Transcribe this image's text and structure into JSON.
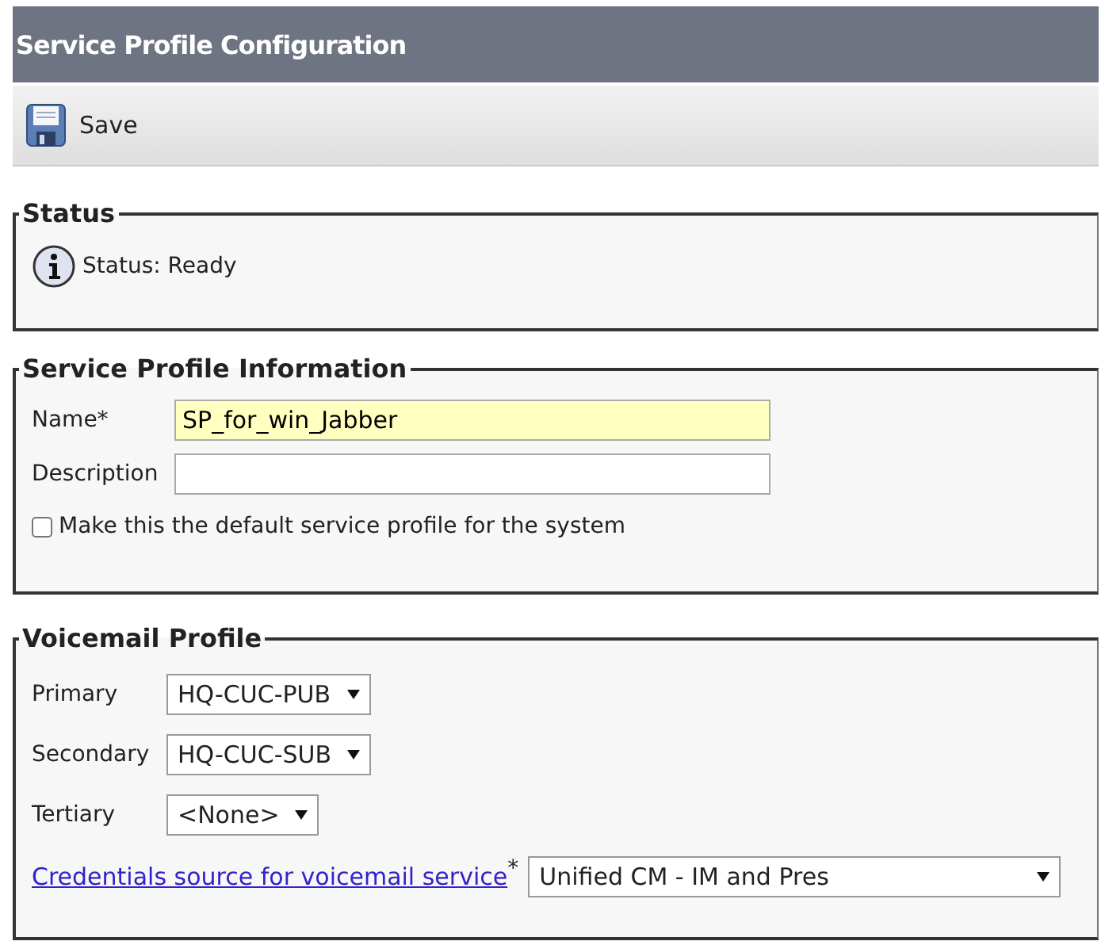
{
  "window": {
    "title": "Service Profile Configuration"
  },
  "toolbar": {
    "buttons": [
      {
        "label": "Save",
        "kind": "save"
      }
    ]
  },
  "status": {
    "legend": "Status",
    "message": "Status: Ready"
  },
  "info": {
    "legend": "Service Profile Information",
    "name": {
      "label": "Name*",
      "value": "SP_for_win_Jabber",
      "highlighted": true
    },
    "description": {
      "label": "Description"
    },
    "default_checkbox": {
      "label": "Make this the default service profile for the system",
      "checked": false
    }
  },
  "voicemail": {
    "legend": "Voicemail Profile",
    "selects": [
      {
        "label": "Primary",
        "value": "HQ-CUC-PUB"
      },
      {
        "label": "Secondary",
        "value": "HQ-CUC-SUB"
      },
      {
        "label": "Tertiary",
        "value": "<None>"
      }
    ],
    "credentials": {
      "link": "Credentials source for voicemail service",
      "required_mark": "*",
      "value": "Unified CM - IM and Pres"
    }
  }
}
